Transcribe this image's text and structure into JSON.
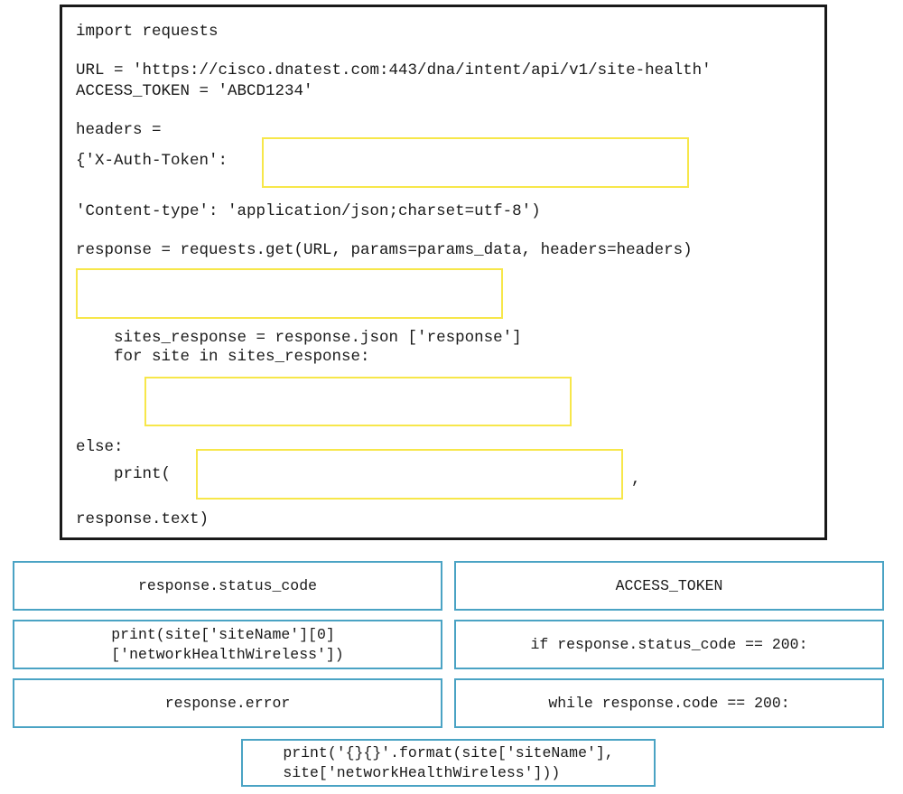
{
  "code_panel": {
    "name": "python-code-snippet",
    "lines": [
      {
        "id": "l1",
        "text": "import requests"
      },
      {
        "id": "l2",
        "text": "URL = 'https://cisco.dnatest.com:443/dna/intent/api/v1/site-health'"
      },
      {
        "id": "l3",
        "text": "ACCESS_TOKEN = 'ABCD1234'"
      },
      {
        "id": "l4",
        "text": "headers ="
      },
      {
        "id": "l5",
        "text": "{'X-Auth-Token':"
      },
      {
        "id": "l6",
        "text": "'Content-type': 'application/json;charset=utf-8')"
      },
      {
        "id": "l7",
        "text": "response = requests.get(URL, params=params_data, headers=headers)"
      },
      {
        "id": "l8",
        "text": "    sites_response = response.json ['response']"
      },
      {
        "id": "l9",
        "text": "    for site in sites_response:"
      },
      {
        "id": "l10",
        "text": "else:"
      },
      {
        "id": "l11",
        "text": "    print("
      },
      {
        "id": "l12",
        "text": ","
      },
      {
        "id": "l13",
        "text": "response.text)"
      }
    ],
    "drop_zones": [
      {
        "id": "dz1",
        "label": "drop-zone-auth-token",
        "value": ""
      },
      {
        "id": "dz2",
        "label": "drop-zone-status-check",
        "value": ""
      },
      {
        "id": "dz3",
        "label": "drop-zone-print-statement",
        "value": ""
      },
      {
        "id": "dz4",
        "label": "drop-zone-error-value",
        "value": ""
      }
    ]
  },
  "options": [
    {
      "id": "opt1",
      "name": "option-response-status-code",
      "text": "response.status_code",
      "align": "center"
    },
    {
      "id": "opt2",
      "name": "option-access-token",
      "text": "ACCESS_TOKEN",
      "align": "center"
    },
    {
      "id": "opt3",
      "name": "option-print-site-sitename",
      "text": "print(site['siteName'][0]\n['networkHealthWireless'])",
      "align": "left"
    },
    {
      "id": "opt4",
      "name": "option-if-response-status-code",
      "text": "if response.status_code == 200:",
      "align": "center"
    },
    {
      "id": "opt5",
      "name": "option-response-error",
      "text": "response.error",
      "align": "center"
    },
    {
      "id": "opt6",
      "name": "option-while-response-code",
      "text": "while response.code == 200:",
      "align": "center"
    },
    {
      "id": "opt7",
      "name": "option-print-format-site",
      "text": "print('{}{}'.format(site['siteName'],\nsite['networkHealthWireless']))",
      "align": "left"
    }
  ],
  "colors": {
    "code_border": "#1a1a1a",
    "drop_zone_border": "#f7e74a",
    "option_border": "#4aa3c4",
    "text": "#1a1a1a",
    "background": "#ffffff"
  }
}
